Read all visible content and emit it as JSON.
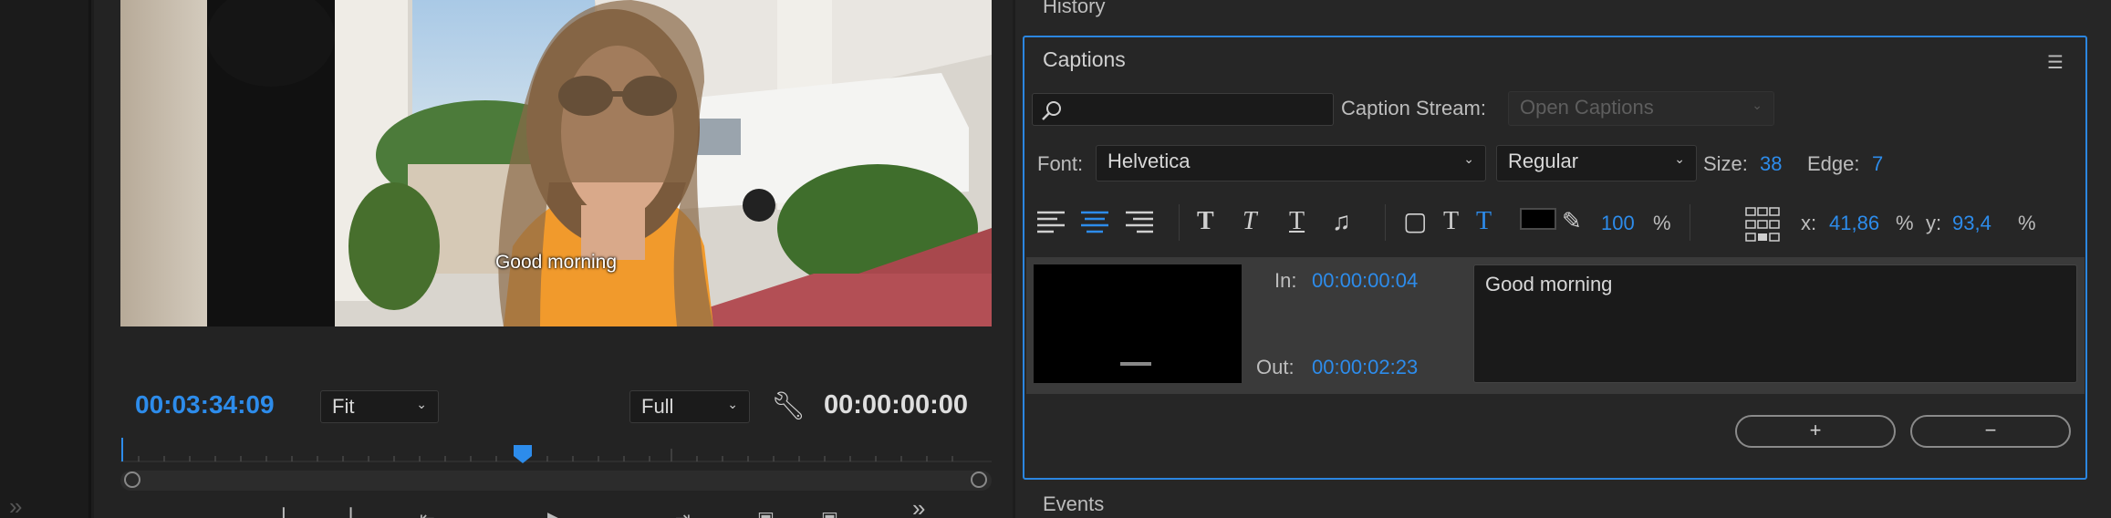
{
  "monitor": {
    "overlay_caption": "Good morning",
    "playhead_timecode": "00:03:34:09",
    "zoom_select": "Fit",
    "resolution_select": "Full",
    "duration_timecode": "00:00:00:00",
    "accent": "#2d8ceb"
  },
  "history": {
    "title": "History"
  },
  "captions": {
    "title": "Captions",
    "search": {
      "placeholder": "",
      "value": ""
    },
    "caption_stream_label": "Caption Stream:",
    "caption_stream_value": "Open Captions",
    "font_label": "Font:",
    "font_value": "Helvetica",
    "style_value": "Regular",
    "size_label": "Size:",
    "size_value": "38",
    "edge_label": "Edge:",
    "edge_value": "7",
    "opacity_value": "100",
    "percent": "%",
    "x_label": "x:",
    "x_value": "41,86",
    "y_label": "y:",
    "y_value": "93,4",
    "in_label": "In:",
    "in_value": "00:00:00:04",
    "out_label": "Out:",
    "out_value": "00:00:02:23",
    "caption_text": "Good morning",
    "add_button": "+",
    "remove_button": "−",
    "swatch_color": "#000000"
  },
  "events": {
    "title": "Events"
  }
}
